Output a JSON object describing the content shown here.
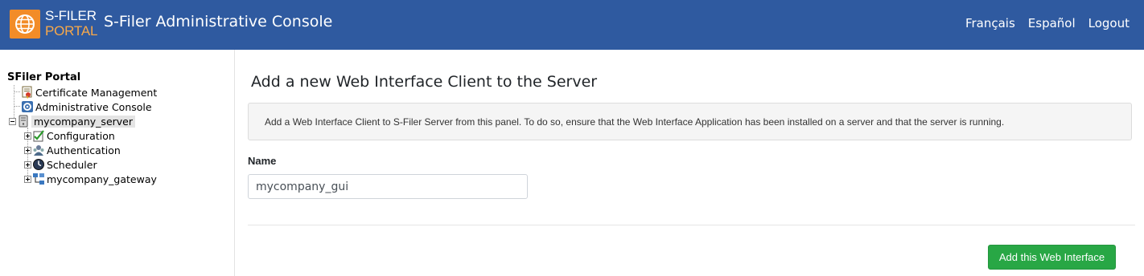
{
  "header": {
    "logo_line1": "S-FILER",
    "logo_line2": "PORTAL",
    "title": "S-Filer Administrative Console",
    "nav": [
      {
        "label": "Français"
      },
      {
        "label": "Español"
      },
      {
        "label": "Logout"
      }
    ],
    "brand_color": "#2f5aa0",
    "logo_color": "#f28c28"
  },
  "sidebar": {
    "root_label": "SFiler Portal",
    "items": [
      {
        "label": "Certificate Management",
        "icon": "certificate-icon"
      },
      {
        "label": "Administrative Console",
        "icon": "gear-icon"
      },
      {
        "label": "mycompany_server",
        "icon": "server-icon",
        "expanded": true,
        "selected": true
      },
      {
        "label": "Configuration",
        "icon": "checklist-icon"
      },
      {
        "label": "Authentication",
        "icon": "users-icon"
      },
      {
        "label": "Scheduler",
        "icon": "clock-icon"
      },
      {
        "label": "mycompany_gateway",
        "icon": "network-icon"
      }
    ]
  },
  "main": {
    "title": "Add a new Web Interface Client to the Server",
    "info": "Add a Web Interface Client to S-Filer Server from this panel. To do so, ensure that the Web Interface Application has been installed on a server and that the server is running.",
    "name_label": "Name",
    "name_value": "mycompany_gui",
    "submit_label": "Add this Web Interface",
    "submit_color": "#28a745"
  }
}
